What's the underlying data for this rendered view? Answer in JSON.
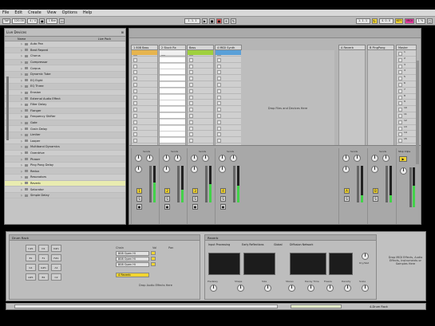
{
  "menu": [
    "File",
    "Edit",
    "Create",
    "View",
    "Options",
    "Help"
  ],
  "transport": {
    "tap_label": "TAP",
    "tempo": "120.00",
    "time_sig": "4 / 4",
    "quantize": "1 Bar",
    "position": "1. 1. 1",
    "loop_start": "1. 1. 1",
    "loop_length": "4. 0. 0",
    "key_label": "KEY",
    "midi_label": "MIDI",
    "cpu": "1 %"
  },
  "browser": {
    "title": "Live Devices",
    "col_name": "Name",
    "col_pack": "Live Pack",
    "items": [
      "Auto Pan",
      "Beat Repeat",
      "Chorus",
      "Compressor",
      "Corpus",
      "Dynamic Tube",
      "EQ Eight",
      "EQ Three",
      "Erosion",
      "External Audio Effect",
      "Filter Delay",
      "Flanger",
      "Frequency Shifter",
      "Gate",
      "Grain Delay",
      "Limiter",
      "Looper",
      "Multiband Dynamics",
      "Overdrive",
      "Phaser",
      "Ping Pong Delay",
      "Redux",
      "Resonators",
      "Reverb",
      "Saturator",
      "Simple Delay"
    ],
    "selected_index": 23
  },
  "session": {
    "tracks": [
      {
        "name": "1 808 Bass",
        "color": "#e6b44e"
      },
      {
        "name": "2 Stuck Rx",
        "color": "#f0f0f0"
      },
      {
        "name": "Bass",
        "color": "#9fd03d"
      },
      {
        "name": "4 MIDI Synth",
        "color": "#5aa0d8"
      }
    ],
    "returns": [
      {
        "name": "A Reverb"
      },
      {
        "name": "B PingPong"
      }
    ],
    "master": {
      "name": "Master"
    },
    "drop_text": "Drop Files and Devices Here",
    "send_label": "Sends",
    "scene_numbers": [
      "1",
      "2",
      "3",
      "4",
      "5",
      "6",
      "7",
      "8",
      "9",
      "10",
      "11",
      "12",
      "13",
      "14",
      "15"
    ],
    "stop_all": "Stop Clips",
    "track_numbers": [
      "1",
      "2",
      "3",
      "4"
    ],
    "return_letters": [
      "A",
      "B"
    ],
    "solo_label": "S"
  },
  "devices": {
    "drum_rack_title": "Drum Rack",
    "pads": [
      "C#1",
      "D1",
      "D#1",
      "E1",
      "F1",
      "F#1",
      "G1",
      "G#1",
      "A1",
      "A#1",
      "B1",
      "C2"
    ],
    "chain_header": [
      "Chain",
      "Vol",
      "Pan"
    ],
    "chains": [
      "808 Open Hi",
      "808 Open Hi",
      "808 Open Hi"
    ],
    "selected_chain": "4 Reverb",
    "drop_audio": "Drop Audio Effects Here",
    "reverb_title": "Reverb",
    "reverb_sections": [
      "Input Processing",
      "Early Reflections",
      "Global",
      "Diffusion Network"
    ],
    "reverb_knobs": [
      "Predelay",
      "Shape",
      "Size",
      "Stereo",
      "Decay Time",
      "Freeze",
      "Density",
      "Scale",
      "Dry/Wet"
    ],
    "hint_text": "Drop MIDI Effects, Audio Effects, Instruments or Samples Here"
  },
  "status": {
    "track_label": "4-Drum Rack"
  }
}
